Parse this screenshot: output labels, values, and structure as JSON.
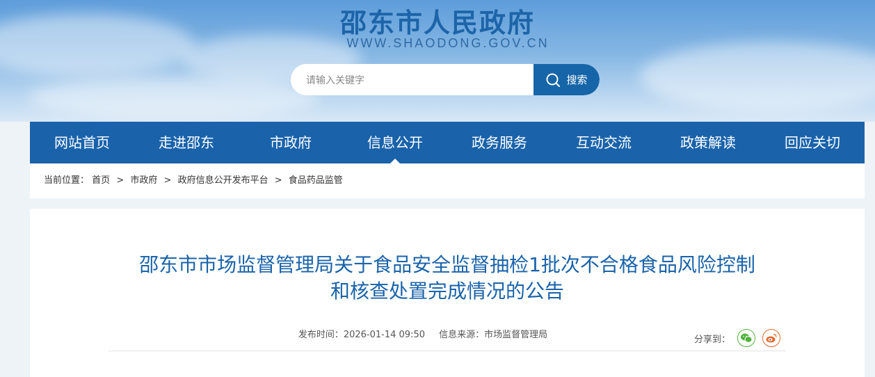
{
  "header": {
    "site_title": "邵东市人民政府",
    "site_url": "WWW.SHAODONG.GOV.CN"
  },
  "search": {
    "placeholder": "请输入关键字",
    "button_label": "搜索"
  },
  "nav": {
    "items": [
      {
        "label": "网站首页"
      },
      {
        "label": "走进邵东"
      },
      {
        "label": "市政府"
      },
      {
        "label": "信息公开"
      },
      {
        "label": "政务服务"
      },
      {
        "label": "互动交流"
      },
      {
        "label": "政策解读"
      },
      {
        "label": "回应关切"
      }
    ],
    "active": "信息公开"
  },
  "breadcrumb": {
    "prefix": "当前位置：",
    "items": [
      "首页",
      "市政府",
      "政府信息公开发布平台",
      "食品药品监管"
    ],
    "separator": ">"
  },
  "article": {
    "title_line1": "邵东市市场监督管理局关于食品安全监督抽检1批次不合格食品风险控制",
    "title_line2": "和核查处置完成情况的公告",
    "publish_time": "发布时间：2026-01-14 09:50",
    "source": "信息来源：市场监督管理局",
    "share_label": "分享到："
  },
  "colors": {
    "brand_blue": "#1a63ab",
    "title_blue": "#1d64a8",
    "wechat_green": "#50b33a",
    "weibo_orange": "#e56a2c"
  }
}
